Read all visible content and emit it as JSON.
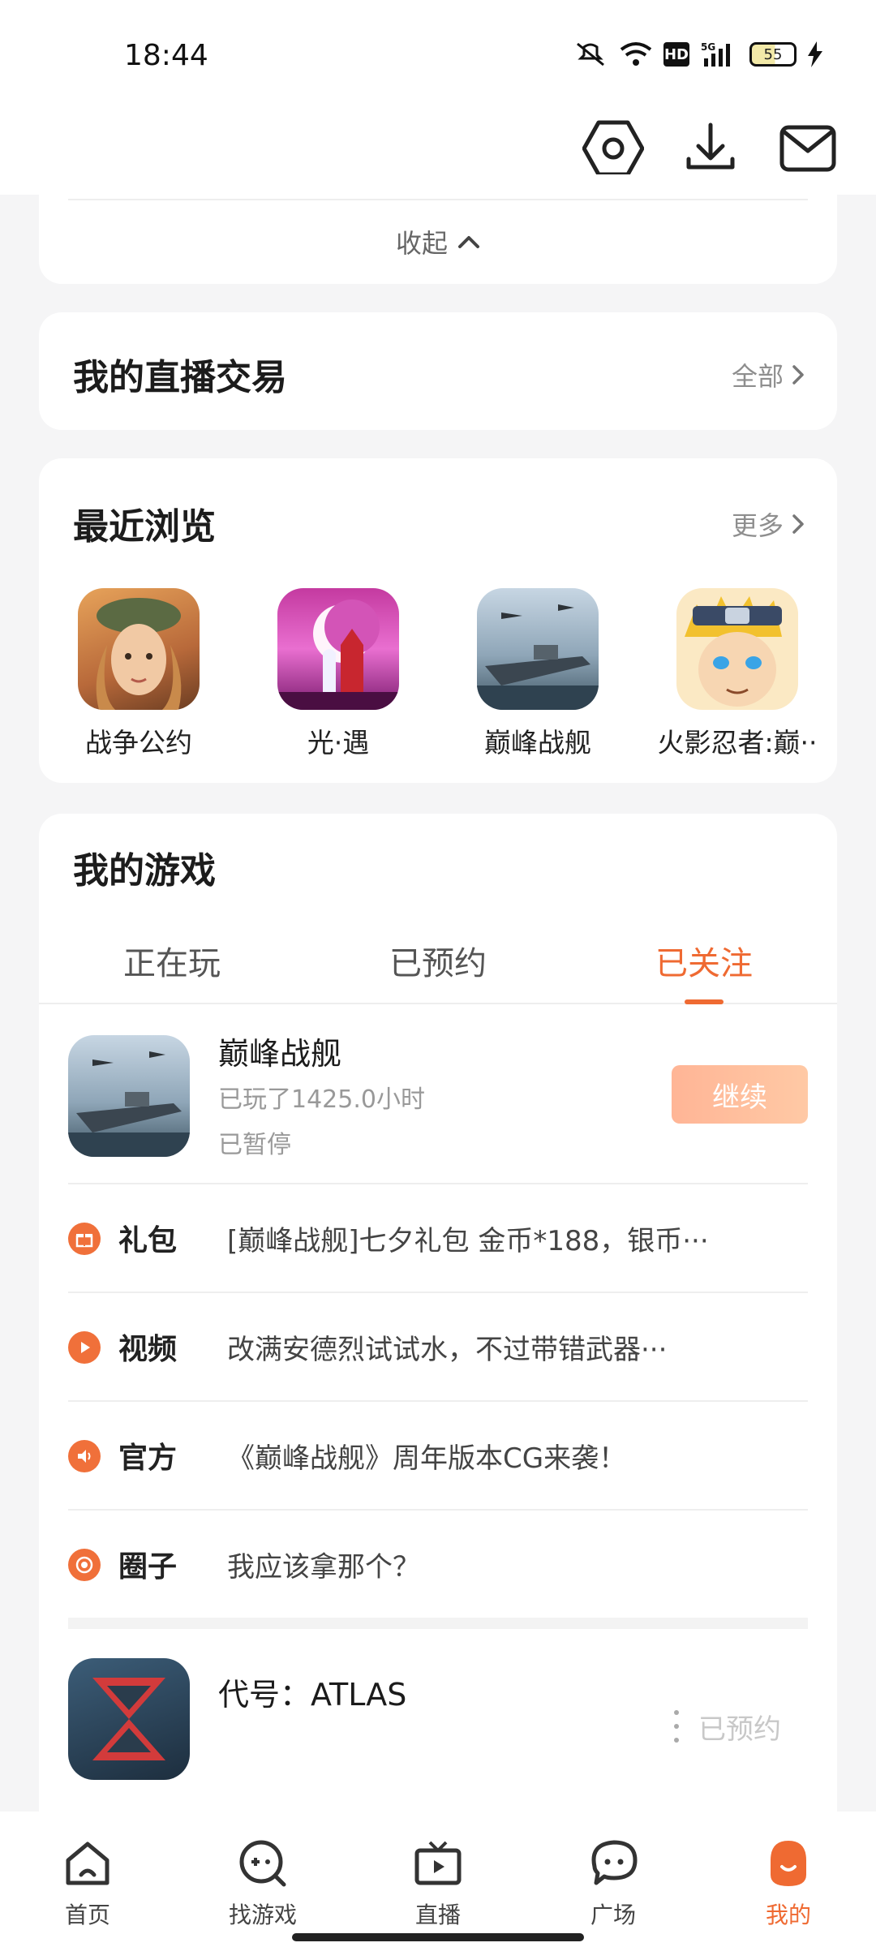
{
  "status_bar": {
    "time": "18:44",
    "hd_label": "HD",
    "network_label": "5G",
    "battery_level": "55"
  },
  "header": {
    "icons": [
      "settings-hex-icon",
      "download-icon",
      "mail-icon"
    ]
  },
  "collapse": {
    "label": "收起"
  },
  "live_trade": {
    "title": "我的直播交易",
    "more": "全部"
  },
  "recent": {
    "title": "最近浏览",
    "more": "更多",
    "items": [
      {
        "name": "战争公约"
      },
      {
        "name": "光·遇"
      },
      {
        "name": "巅峰战舰"
      },
      {
        "name": "火影忍者:巅··"
      }
    ]
  },
  "my_games": {
    "title": "我的游戏",
    "tabs": [
      {
        "label": "正在玩"
      },
      {
        "label": "已预约"
      },
      {
        "label": "已关注"
      }
    ],
    "active_tab": 2,
    "game1": {
      "name": "巅峰战舰",
      "played": "已玩了1425.0小时",
      "status": "已暂停",
      "button": "继续"
    },
    "info_rows": [
      {
        "label": "礼包",
        "text": "[巅峰战舰]七夕礼包 金币*188，银币···"
      },
      {
        "label": "视频",
        "text": "改满安德烈试试水，不过带错武器···"
      },
      {
        "label": "官方",
        "text": "《巅峰战舰》周年版本CG来袭！"
      },
      {
        "label": "圈子",
        "text": "我应该拿那个？"
      }
    ],
    "game2": {
      "name": "代号：ATLAS",
      "button": "已预约"
    }
  },
  "bottom_nav": [
    {
      "label": "首页"
    },
    {
      "label": "找游戏"
    },
    {
      "label": "直播"
    },
    {
      "label": "广场"
    },
    {
      "label": "我的"
    }
  ],
  "colors": {
    "accent": "#ef6a32",
    "background": "#f5f5f6"
  }
}
